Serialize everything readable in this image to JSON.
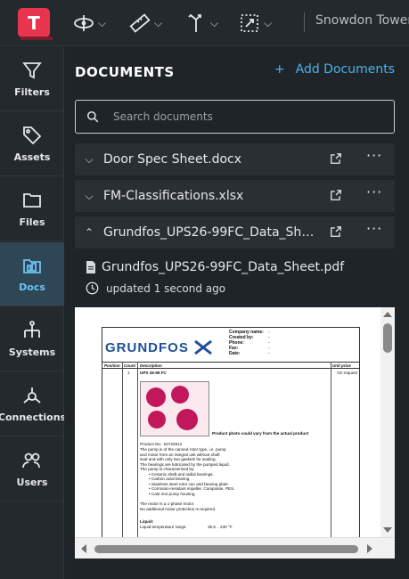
{
  "app": {
    "logo_letter": "T",
    "project_name": "Snowdon Towers"
  },
  "toolbar": {
    "tools": [
      {
        "icon": "orbit-icon"
      },
      {
        "icon": "measure-icon"
      },
      {
        "icon": "transform-icon"
      },
      {
        "icon": "section-box-icon"
      }
    ]
  },
  "sidebar": {
    "items": [
      {
        "label": "Filters",
        "icon": "filter-icon"
      },
      {
        "label": "Assets",
        "icon": "tag-icon"
      },
      {
        "label": "Files",
        "icon": "folder-icon"
      },
      {
        "label": "Docs",
        "icon": "docs-icon",
        "active": true
      },
      {
        "label": "Systems",
        "icon": "systems-icon"
      },
      {
        "label": "Connections",
        "icon": "connections-icon"
      },
      {
        "label": "Users",
        "icon": "users-icon"
      }
    ]
  },
  "documents": {
    "title": "DOCUMENTS",
    "add_label": "Add Documents",
    "search_placeholder": "Search documents",
    "rows": [
      {
        "name": "Door Spec Sheet.docx",
        "expanded": false
      },
      {
        "name": "FM-Classifications.xlsx",
        "expanded": false
      },
      {
        "name": "Grundfos_UPS26-99FC_Data_Sheet.pdf",
        "expanded": true
      }
    ],
    "expanded_file": {
      "filename": "Grundfos_UPS26-99FC_Data_Sheet.pdf",
      "updated": "updated 1 second ago"
    }
  },
  "pdf": {
    "brand": "GRUNDFOS",
    "company_labels": [
      "Company name:",
      "Created by:",
      "Phone:",
      "Fax:",
      "Date:"
    ],
    "company_values": [
      "-",
      "-",
      "-",
      "-",
      "-"
    ],
    "headers": {
      "position": "Position",
      "count": "Count",
      "description": "Description",
      "unit_price": "Unit price"
    },
    "count": "1",
    "product": "UPS 26-99 FC",
    "unit_price": "On request",
    "photo_note": "Product photo could vary from the actual product",
    "product_no": "Product No.: 52722512",
    "desc_lines": [
      "The pump is of the canned rotor type, i.e. pump",
      "and motor form an integral unit without shaft",
      "seal and with only two gaskets for sealing.",
      "The bearings are lubricated by the pumped liquid.",
      "The pump is characterized by:"
    ],
    "bullets": [
      "Ceramic shaft and radial bearings.",
      "Carbon axial bearing.",
      "Stainless steel rotor can and bearing plate.",
      "Corrosion-resistant impeller, Composite, PES.",
      "Cast iron pump housing."
    ],
    "motor_lines": [
      "The motor is a 1-phase motor.",
      "No additional motor protection is required."
    ],
    "liquid_heading": "Liquid:",
    "liquid_range_label": "Liquid temperature range:",
    "liquid_range_value": "35.6 .. 230 °F"
  }
}
